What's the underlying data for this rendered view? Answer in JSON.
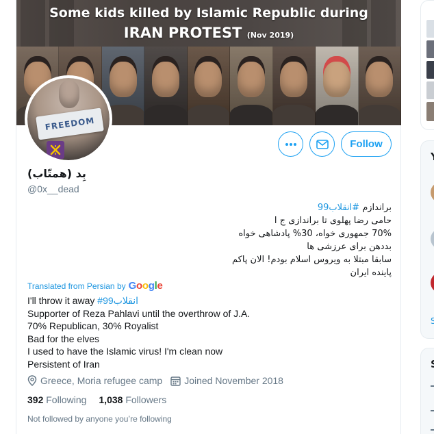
{
  "banner": {
    "title_line1": "Some kids killed by Islamic Republic during",
    "title_line2": "IRAN PROTEST",
    "title_date": "(Nov 2019)",
    "photo_tones": [
      "#6b5a4c",
      "#5c4a3d",
      "#4d5560",
      "#3c3634",
      "#5a4535",
      "#7a6a58",
      "#4f3f36",
      "#b8b0a5",
      "#5d4c40"
    ]
  },
  "avatar": {
    "tape_text": "FREEDOM"
  },
  "actions": {
    "more_icon": "more-dots-icon",
    "message_icon": "envelope-icon",
    "follow_label": "Follow"
  },
  "profile": {
    "display_name": "بِد (همتّاب)",
    "handle": "@0x__dead",
    "bio_rtl": [
      "براندازم #انقلاب99",
      "حامی رضا پهلوی تا براندازی ج ا",
      "70% جمهوری خواه، 30% پادشاهی خواه",
      "بددهن برای عرزشی ها",
      "سابقا مبتلا به ویروس اسلام بودم! الان پاکم",
      "پاینده ایران"
    ],
    "translated_label": "Translated from Persian by",
    "translator": "Google",
    "bio_en_line1": "I'll throw it away ",
    "bio_en_hashtag": "#انقلاب99",
    "bio_en": [
      " Supporter of Reza Pahlavi until the overthrow of J.A.",
      " 70% Republican, 30% Royalist",
      " Bad for the elves",
      " I used to have the Islamic virus! I'm clean now",
      " Persistent of Iran"
    ],
    "location": "Greece, Moria refugee camp",
    "joined": "Joined November 2018",
    "following_count": "392",
    "following_label": "Following",
    "followers_count": "1,038",
    "followers_label": "Followers",
    "followed_by_note": "Not followed by anyone you’re following"
  },
  "colors": {
    "accent": "#1da1f2",
    "link": "#1b95e0",
    "secondary_text": "#657786"
  },
  "sidebar": {
    "letter_1": "Y",
    "letter_2": "S",
    "letter_3": "S"
  }
}
